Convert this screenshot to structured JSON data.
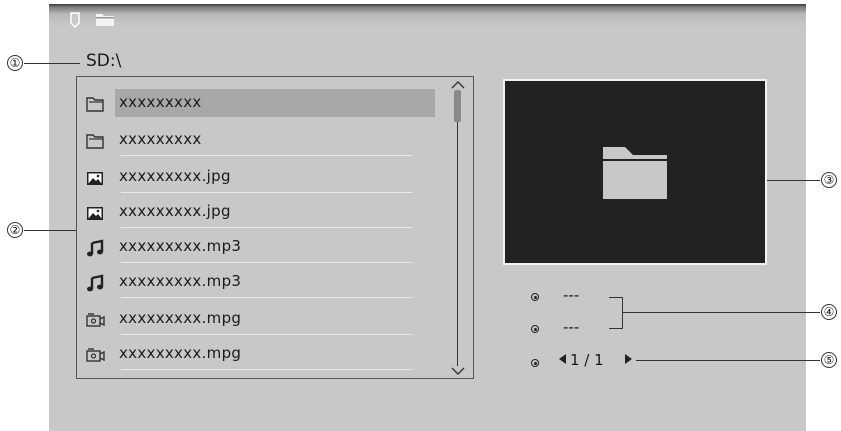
{
  "topbar": {
    "icons": [
      "sd-card-icon",
      "folder-icon"
    ]
  },
  "path": "SD:\\",
  "callouts": [
    "①",
    "②",
    "③",
    "④",
    "⑤"
  ],
  "files": [
    {
      "name": "xxxxxxxxx",
      "type": "folder",
      "icon": "folder-icon",
      "selected": true
    },
    {
      "name": "xxxxxxxxx",
      "type": "folder",
      "icon": "folder-icon",
      "selected": false
    },
    {
      "name": "xxxxxxxxx.jpg",
      "type": "image",
      "icon": "image-icon",
      "selected": false
    },
    {
      "name": "xxxxxxxxx.jpg",
      "type": "image",
      "icon": "image-icon",
      "selected": false
    },
    {
      "name": "xxxxxxxxx.mp3",
      "type": "audio",
      "icon": "music-note-icon",
      "selected": false
    },
    {
      "name": "xxxxxxxxx.mp3",
      "type": "audio",
      "icon": "music-note-icon",
      "selected": false
    },
    {
      "name": "xxxxxxxxx.mpg",
      "type": "video",
      "icon": "video-icon",
      "selected": false
    },
    {
      "name": "xxxxxxxxx.mpg",
      "type": "video",
      "icon": "video-icon",
      "selected": false
    }
  ],
  "preview": {
    "icon": "folder-icon"
  },
  "info": [
    "---",
    "---"
  ],
  "pager": {
    "text": "1 / 1"
  }
}
